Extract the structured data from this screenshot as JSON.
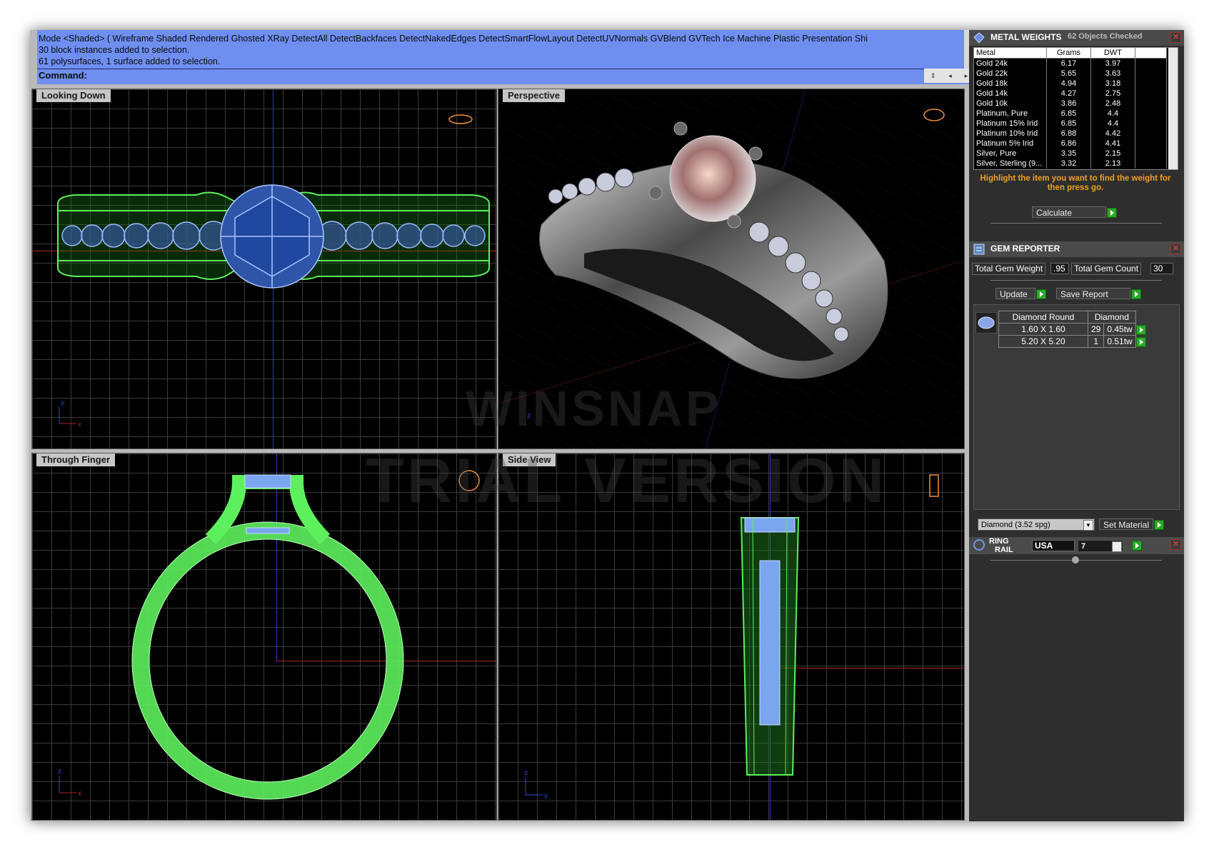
{
  "command_area": {
    "mode_line": "Mode <Shaded> ( Wireframe  Shaded  Rendered  Ghosted  XRay  DetectAll  DetectBackfaces  DetectNakedEdges  DetectSmartFlowLayout  DetectUVNormals  GVBlend  GVTech  Ice  Machine  Plastic  Presentation  Shi",
    "history_1": "30 block instances added to selection.",
    "history_2": "61 polysurfaces, 1 surface added to selection.",
    "prompt_label": "Command:"
  },
  "viewports": {
    "top": "Looking Down",
    "perspective": "Perspective",
    "front": "Through Finger",
    "side": "Side View",
    "axis_labels": {
      "x": "x",
      "y": "y",
      "z": "z"
    }
  },
  "watermark": {
    "line1": "WINSNAP",
    "line2": "TRIAL VERSION"
  },
  "metal_weights": {
    "title": "METAL WEIGHTS",
    "status": "62 Objects Checked",
    "columns": [
      "Metal",
      "Grams",
      "DWT"
    ],
    "rows": [
      [
        "Gold 24k",
        "6.17",
        "3.97"
      ],
      [
        "Gold 22k",
        "5.65",
        "3.63"
      ],
      [
        "Gold 18k",
        "4.94",
        "3.18"
      ],
      [
        "Gold 14k",
        "4.27",
        "2.75"
      ],
      [
        "Gold 10k",
        "3.86",
        "2.48"
      ],
      [
        "Platinum, Pure",
        "6.85",
        "4.4"
      ],
      [
        "Platinum 15% Irid",
        "6.85",
        "4.4"
      ],
      [
        "Platinum 10% Irid",
        "6.88",
        "4.42"
      ],
      [
        "Platinum 5% Irid",
        "6.86",
        "4.41"
      ],
      [
        "Silver, Pure",
        "3.35",
        "2.15"
      ],
      [
        "Silver, Sterling (9...",
        "3.32",
        "2.13"
      ]
    ],
    "hint": "Highlight the item you want to find the weight for then press go.",
    "calculate_label": "Calculate"
  },
  "gem_reporter": {
    "title": "GEM REPORTER",
    "total_weight_label": "Total Gem Weight",
    "total_weight_value": ".95",
    "total_count_label": "Total Gem Count",
    "total_count_value": "30",
    "update_label": "Update",
    "save_label": "Save Report",
    "gem_columns": [
      "Diamond Round",
      "Diamond"
    ],
    "gem_rows": [
      {
        "size": "1.60 X 1.60",
        "count": "29",
        "weight": "0.45tw"
      },
      {
        "size": "5.20 X 5.20",
        "count": "1",
        "weight": "0.51tw"
      }
    ],
    "material_select": "Diamond    (3.52 spg)",
    "set_material_label": "Set Material"
  },
  "ring_rail": {
    "title_1": "RING",
    "title_2": "RAIL",
    "region_value": "USA",
    "size_value": "7"
  },
  "colors": {
    "command_bg": "#6f8ff0",
    "wire_green": "#5df05d",
    "gem_blue": "#7aa6f0",
    "hint_orange": "#f0a020",
    "go_green": "#2aa82a"
  }
}
